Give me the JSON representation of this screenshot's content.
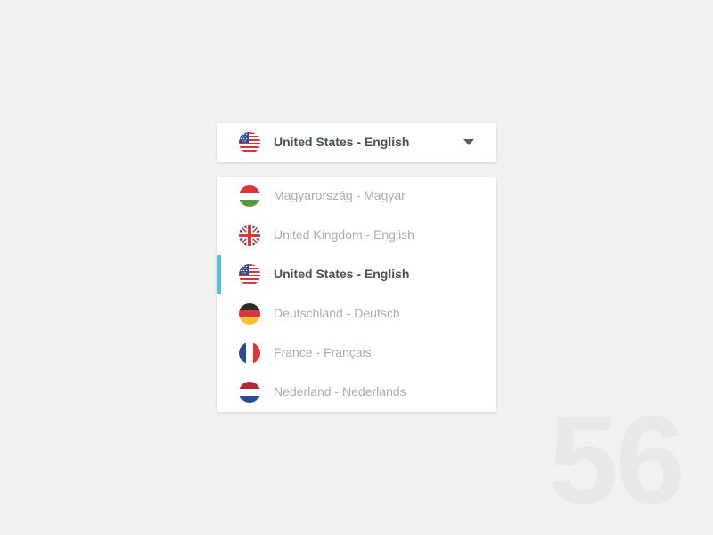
{
  "selector": {
    "label": "United States - English",
    "flag_icon": "flag-us-icon",
    "caret_icon": "chevron-down-icon"
  },
  "menu": {
    "items": [
      {
        "label": "Magyarország - Magyar",
        "flag_icon": "flag-hu-icon",
        "selected": false
      },
      {
        "label": "United Kingdom - English",
        "flag_icon": "flag-uk-icon",
        "selected": false
      },
      {
        "label": "United States - English",
        "flag_icon": "flag-us-icon",
        "selected": true
      },
      {
        "label": "Deutschland - Deutsch",
        "flag_icon": "flag-de-icon",
        "selected": false
      },
      {
        "label": "France - Français",
        "flag_icon": "flag-fr-icon",
        "selected": false
      },
      {
        "label": "Nederland - Nederlands",
        "flag_icon": "flag-nl-icon",
        "selected": false
      }
    ]
  },
  "watermark": "56",
  "colors": {
    "background": "#f1f1f0",
    "selected_indicator": "#4fc1e9",
    "text_selected": "#4b4f57",
    "text_muted": "#a9acb1"
  }
}
